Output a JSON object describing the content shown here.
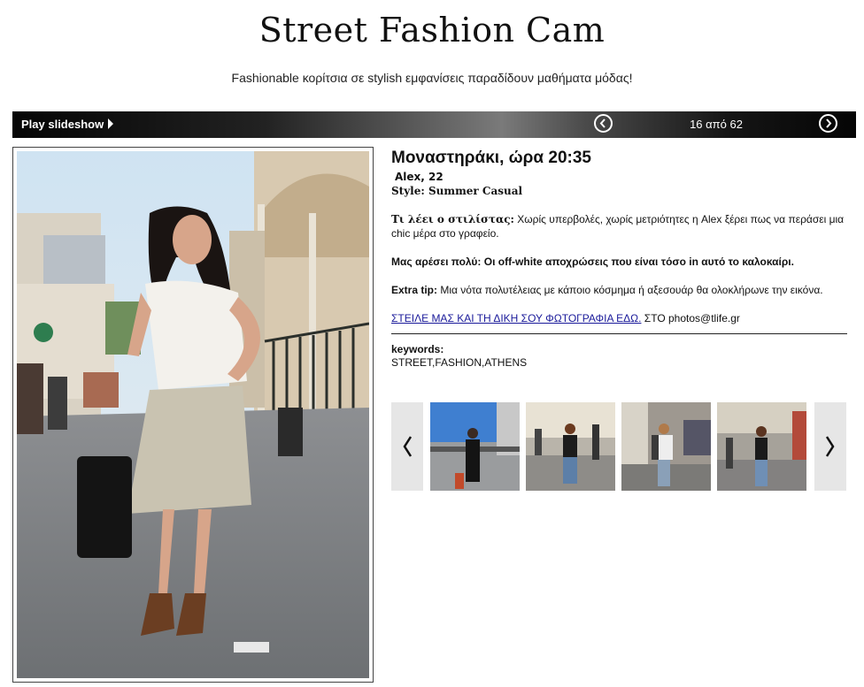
{
  "header": {
    "title": "Street Fashion Cam",
    "subtitle": "Fashionable κορίτσια σε stylish εμφανίσεις παραδίδουν μαθήματα μόδας!"
  },
  "slideshow": {
    "play_label": "Play slideshow",
    "counter": "16 από 62",
    "prev_icon": "circle-chevron-left-icon",
    "next_icon": "circle-chevron-right-icon"
  },
  "detail": {
    "title": "Μοναστηράκι, ώρα 20:35",
    "name": "Alex, 22",
    "style_label": "Style:",
    "style_value": "Summer Casual",
    "stylist_label": "Τι λέει ο στιλίστας:",
    "stylist_text": "Χωρίς υπερβολές, χωρίς μετριότητες η Alex ξέρει πως να περάσει μια chic μέρα στο γραφείο.",
    "likes_label": "Μας αρέσει πολύ:",
    "likes_text": "Οι off-white αποχρώσεις που είναι τόσο in αυτό το καλοκαίρι.",
    "tip_label": "Extra tip:",
    "tip_text": "Μια νότα πολυτέλειας με κάποιο κόσμημα ή αξεσουάρ θα ολοκλήρωνε την εικόνα.",
    "send_link": "ΣΤΕΙΛΕ ΜΑΣ ΚΑΙ ΤΗ ΔΙΚΗ ΣΟΥ ΦΩΤΟΓΡΑΦΙΑ ΕΔΩ.",
    "send_suffix": "ΣΤΟ photos@tlife.gr",
    "keywords_label": "keywords:",
    "keywords_value": "STREET,FASHION,ATHENS"
  },
  "thumbnails": {
    "prev_icon": "chevron-left-icon",
    "next_icon": "chevron-right-icon",
    "count": 4
  }
}
